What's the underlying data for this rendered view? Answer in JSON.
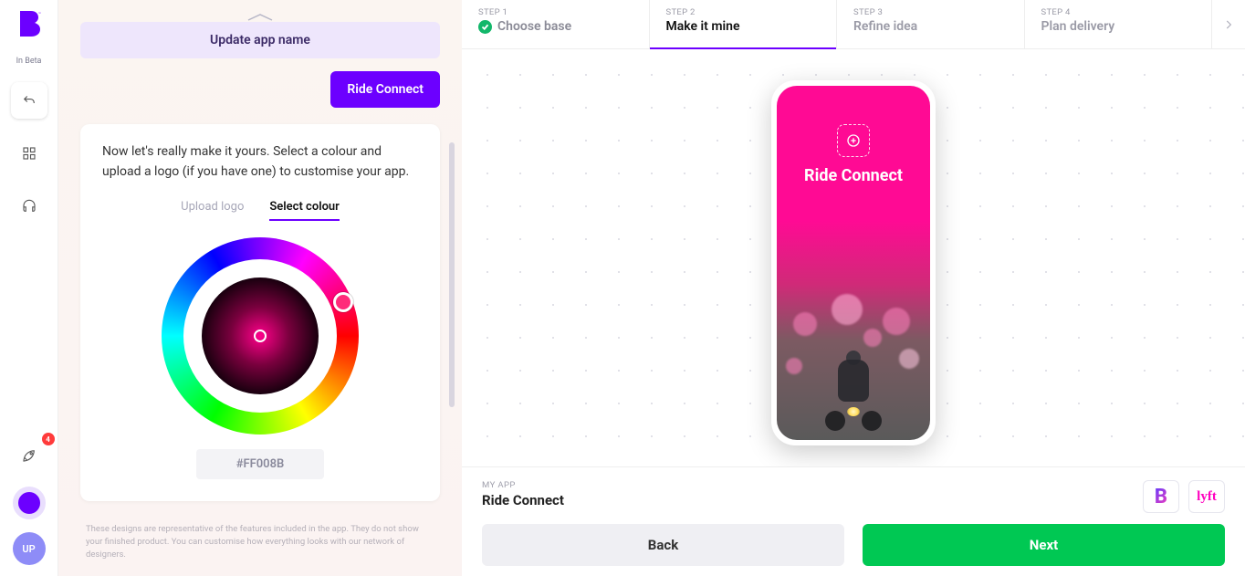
{
  "rail": {
    "beta_label": "In Beta",
    "avatar_text": "UP",
    "rocket_badge": "4"
  },
  "panel": {
    "update_btn": "Update app name",
    "chip": "Ride Connect",
    "card_text": "Now let's really make it yours. Select a colour and upload a logo (if you have one) to customise your app.",
    "tabs": {
      "upload": "Upload logo",
      "colour": "Select colour"
    },
    "hex": "#FF008B",
    "disclaimer": "These designs are representative of the features included in the app. They do not show your finished product. You can customise how everything looks with our network of designers."
  },
  "steps": [
    {
      "num": "STEP 1",
      "title": "Choose base",
      "state": "done"
    },
    {
      "num": "STEP 2",
      "title": "Make it mine",
      "state": "active"
    },
    {
      "num": "STEP 3",
      "title": "Refine idea",
      "state": ""
    },
    {
      "num": "STEP 4",
      "title": "Plan delivery",
      "state": ""
    }
  ],
  "phone": {
    "title": "Ride Connect"
  },
  "footer": {
    "label": "MY APP",
    "name": "Ride Connect",
    "brand_b": "B",
    "brand_lyft": "lyft",
    "back": "Back",
    "next": "Next"
  },
  "colors": {
    "accent": "#6c00ff",
    "select": "#FF008B",
    "success": "#00c853"
  }
}
